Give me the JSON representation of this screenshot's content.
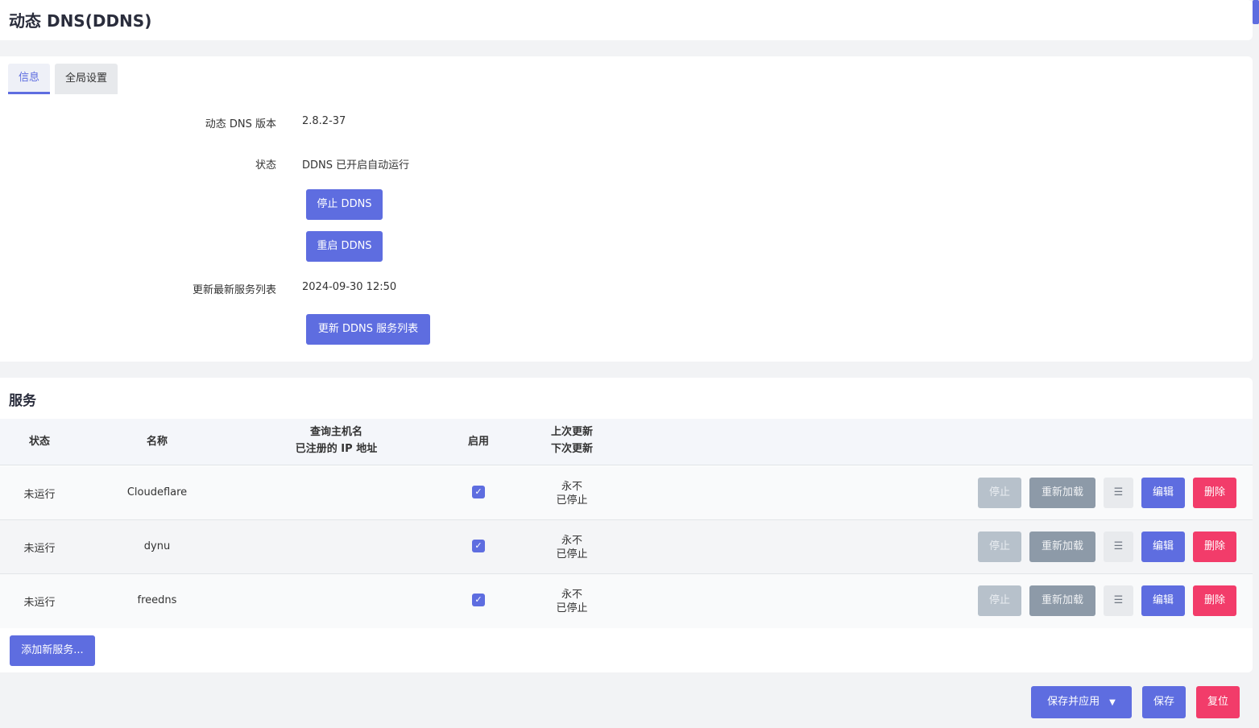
{
  "page": {
    "title": "动态 DNS(DDNS)"
  },
  "tabs": [
    {
      "label": "信息"
    },
    {
      "label": "全局设置"
    }
  ],
  "info": {
    "version_label": "动态 DNS 版本",
    "version_value": "2.8.2-37",
    "status_label": "状态",
    "status_value": "DDNS 已开启自动运行",
    "stop_button": "停止 DDNS",
    "restart_button": "重启 DDNS",
    "list_label": "更新最新服务列表",
    "list_value": "2024-09-30 12:50",
    "update_list_button": "更新 DDNS 服务列表"
  },
  "services": {
    "title": "服务",
    "headers": {
      "status": "状态",
      "name": "名称",
      "host_line1": "查询主机名",
      "host_line2": "已注册的 IP 地址",
      "enabled": "启用",
      "update_line1": "上次更新",
      "update_line2": "下次更新"
    },
    "rows": [
      {
        "status": "未运行",
        "name": "Cloudeflare",
        "last": "永不",
        "next": "已停止"
      },
      {
        "status": "未运行",
        "name": "dynu",
        "last": "永不",
        "next": "已停止"
      },
      {
        "status": "未运行",
        "name": "freedns",
        "last": "永不",
        "next": "已停止"
      }
    ],
    "row_buttons": {
      "stop": "停止",
      "reload": "重新加载",
      "drag": "☰",
      "edit": "编辑",
      "delete": "删除"
    },
    "add_button": "添加新服务..."
  },
  "footer": {
    "save_apply": "保存并应用",
    "save_apply_caret": "▼",
    "save": "保存",
    "reset": "复位"
  },
  "icons": {
    "checkbox": "check-icon",
    "drag_handle": "drag-handle-icon",
    "dropdown": "caret-down-icon"
  },
  "colors": {
    "primary": "#5e6de0",
    "danger": "#f23c6a",
    "disabled": "#b7c1cb",
    "grey": "#8d9aa8"
  }
}
